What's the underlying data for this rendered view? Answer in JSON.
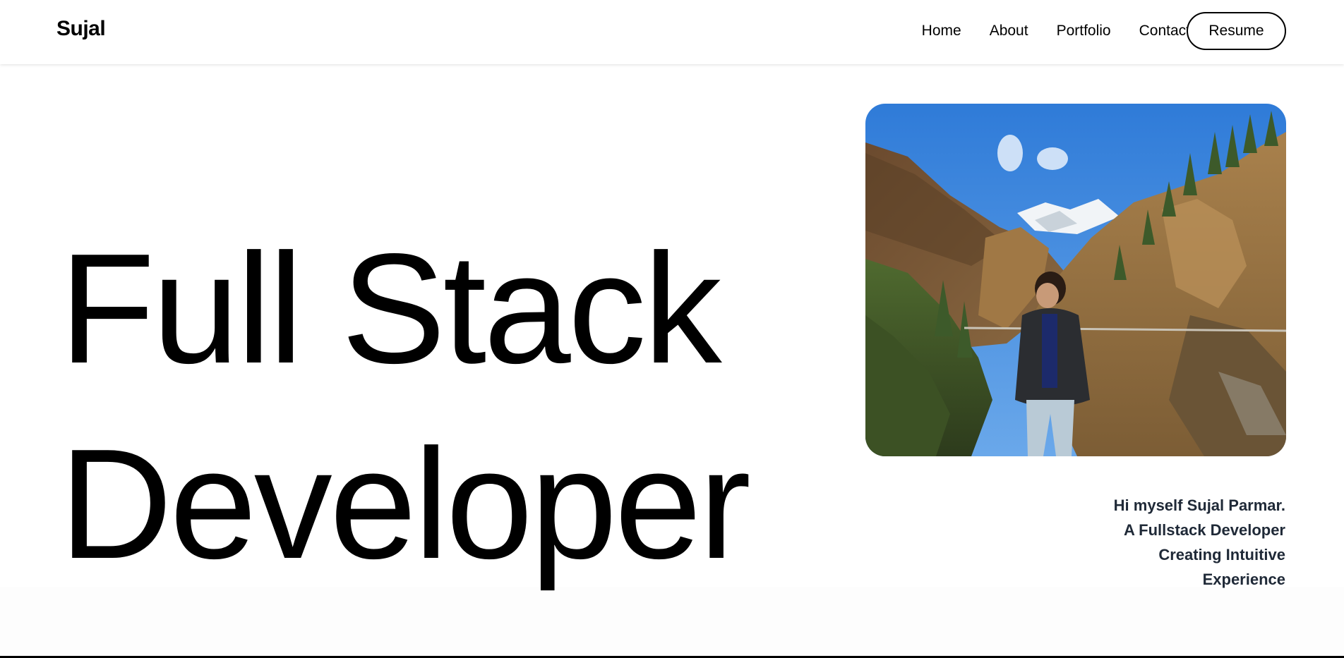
{
  "header": {
    "brand": "Sujal",
    "nav": [
      "Home",
      "About",
      "Portfolio",
      "Contact"
    ],
    "resume_label": "Resume"
  },
  "hero": {
    "title_line1": "Full Stack",
    "title_line2": "Developer"
  },
  "intro": {
    "lines": [
      "Hi myself Sujal Parmar.",
      "A Fullstack Developer",
      "Creating Intuitive",
      "Experience"
    ]
  },
  "colors": {
    "background": "#ffffff",
    "text": "#000000",
    "intro_text": "#1f2937",
    "sky": "#3f86dd"
  },
  "icons": {
    "photo": "profile-photo"
  }
}
